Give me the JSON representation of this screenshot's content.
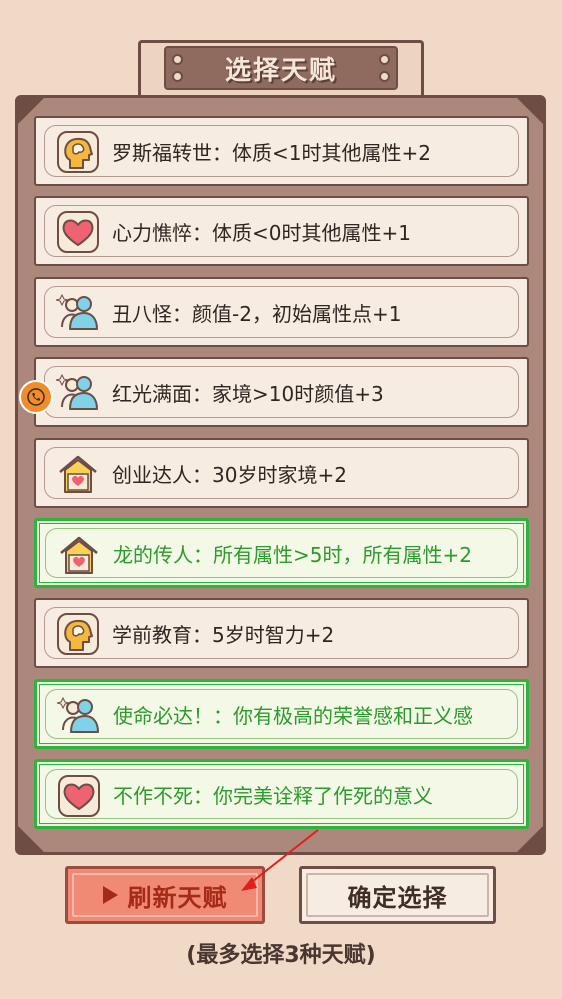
{
  "header": {
    "title": "选择天赋"
  },
  "talents": [
    {
      "icon": "brain-head-icon",
      "label": "罗斯福转世：体质<1时其他属性+2",
      "selected": false
    },
    {
      "icon": "heart-icon",
      "label": "心力憔悴：体质<0时其他属性+1",
      "selected": false
    },
    {
      "icon": "people-icon",
      "label": "丑八怪：颜值-2，初始属性点+1",
      "selected": false
    },
    {
      "icon": "people-icon",
      "label": "红光满面：家境>10时颜值+3",
      "selected": false
    },
    {
      "icon": "house-heart-icon",
      "label": "创业达人：30岁时家境+2",
      "selected": false
    },
    {
      "icon": "house-heart-icon",
      "label": "龙的传人：所有属性>5时，所有属性+2",
      "selected": true
    },
    {
      "icon": "brain-head-icon",
      "label": "学前教育：5岁时智力+2",
      "selected": false
    },
    {
      "icon": "people-icon",
      "label": "使命必达！：你有极高的荣誉感和正义感",
      "selected": true
    },
    {
      "icon": "heart-icon",
      "label": "不作不死：你完美诠释了作死的意义",
      "selected": true
    }
  ],
  "buttons": {
    "refresh_label": "刷新天赋",
    "confirm_label": "确定选择"
  },
  "hint": "(最多选择3种天赋)",
  "colors": {
    "selected_border": "#2fb23f",
    "selected_text": "#2c9a2c",
    "refresh_bg": "#f08a74"
  }
}
